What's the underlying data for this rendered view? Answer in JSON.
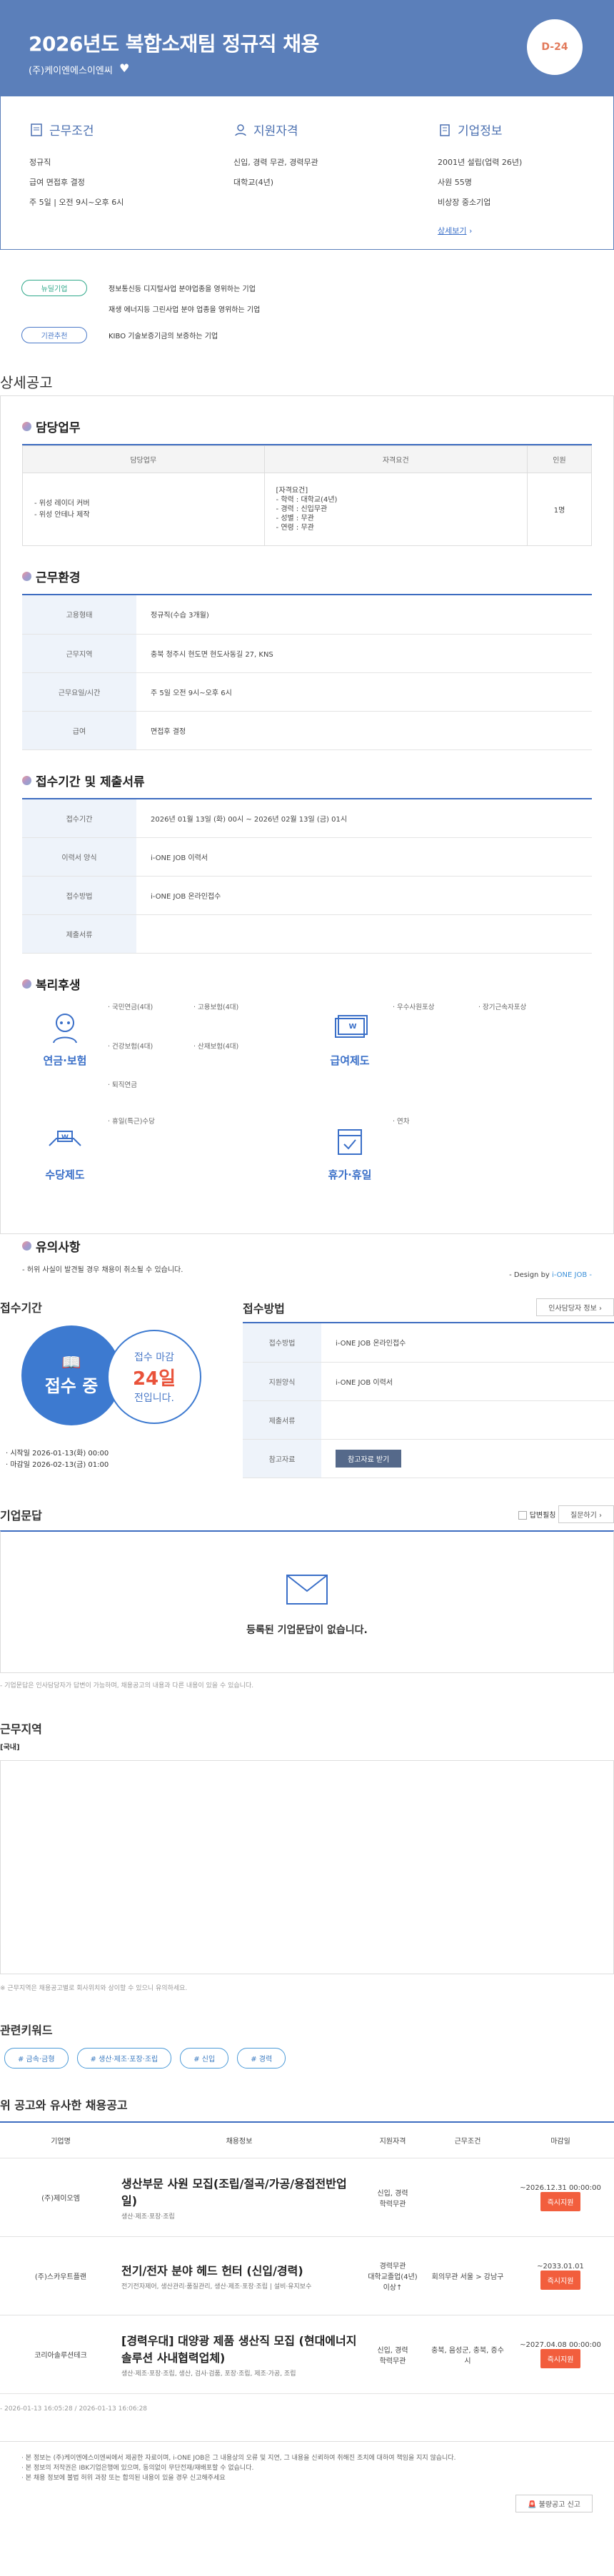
{
  "header": {
    "title": "2026년도 복합소재팀 정규직 채용",
    "company": "(주)케이엔에스이엔씨",
    "dday": "D-24"
  },
  "summary": {
    "cond": {
      "title": "근무조건",
      "lines": [
        "정규직",
        "급여 면접후 결정",
        "주 5일 | 오전 9시~오후 6시"
      ]
    },
    "qual": {
      "title": "지원자격",
      "lines": [
        "신입, 경력 무관, 경력무관",
        "대학교(4년)"
      ]
    },
    "company": {
      "title": "기업정보",
      "lines": [
        "2001년 설립(업력 26년)",
        "사원 55명",
        "비상장 중소기업"
      ],
      "link": "상세보기"
    }
  },
  "badges": [
    {
      "label": "뉴딜기업",
      "text": "정보통신등 디지털사업 분야업종을 영위하는 기업"
    },
    {
      "label": "",
      "text": "재생 에너지등 그린사업 분야 업종을 영위하는 기업"
    },
    {
      "label": "기관추천",
      "text": "KIBO 기술보증기금의 보증하는 기업"
    }
  ],
  "detail": {
    "title": "상세공고"
  },
  "duty": {
    "title": "담당업무",
    "headers": [
      "담당업무",
      "자격요건",
      "인원"
    ],
    "tasks": [
      "- 위성 레이더 커버",
      "- 위성 안테나 제작"
    ],
    "quals": [
      "[자격요건]",
      "- 학력 : 대학교(4년)",
      "- 경력 : 신입무관",
      "- 성별 : 무관",
      "- 연령 : 무관"
    ],
    "count": "1명"
  },
  "env": {
    "title": "근무환경",
    "rows": [
      {
        "k": "고용형태",
        "v": "정규직(수습 3개월)"
      },
      {
        "k": "근무지역",
        "v": "충북 청주시 현도면 현도사동길 27, KNS"
      },
      {
        "k": "근무요일/시간",
        "v": "주 5일 오전 9시~오후 6시"
      },
      {
        "k": "급여",
        "v": "면접후 결정"
      }
    ]
  },
  "period": {
    "title": "접수기간 및 제출서류",
    "rows": [
      {
        "k": "접수기간",
        "v": "2026년 01월 13일 (화) 00시 ~ 2026년 02월 13일 (금) 01시"
      },
      {
        "k": "이력서 양식",
        "v": "i-ONE JOB 이력서"
      },
      {
        "k": "접수방법",
        "v": "i-ONE JOB 온라인접수"
      },
      {
        "k": "제출서류",
        "v": ""
      }
    ]
  },
  "welfare": {
    "title": "복리후생",
    "groups": [
      {
        "name": "연금·보험",
        "items": [
          "· 국민연금(4대)",
          "· 고용보험(4대)",
          "· 건강보험(4대)",
          "· 산재보험(4대)",
          "· 퇴직연금",
          ""
        ]
      },
      {
        "name": "급여제도",
        "items": [
          "· 우수사원포상",
          "· 장기근속자포상"
        ]
      },
      {
        "name": "수당제도",
        "items": [
          "· 휴일(특근)수당"
        ]
      },
      {
        "name": "휴가·휴일",
        "items": [
          "· 연차"
        ]
      }
    ]
  },
  "notice": {
    "title": "유의사항",
    "text": "- 허위 사실이 발견될 경우 채용이 취소될 수 있습니다.",
    "design_prefix": "- Design by ",
    "design_brand": "i-ONE JOB -"
  },
  "receive": {
    "title": "접수기간",
    "status": "접수 중",
    "deadline_label": "접수 마감",
    "days": "24일",
    "deadline_suffix": "전입니다.",
    "start": "· 시작일 2026-01-13(화) 00:00",
    "end": "· 마감일 2026-02-13(금) 01:00"
  },
  "method": {
    "title": "접수방법",
    "link": "인사담당자 정보",
    "rows": [
      {
        "k": "접수방법",
        "v": "i-ONE JOB 온라인접수"
      },
      {
        "k": "지원양식",
        "v": "i-ONE JOB 이력서"
      },
      {
        "k": "제출서류",
        "v": ""
      },
      {
        "k": "참고자료",
        "v": ""
      }
    ],
    "ref_btn": "참고자료 받기"
  },
  "qna": {
    "title": "기업문답",
    "checkbox": "답변필칭",
    "sort": "질문하기",
    "empty": "등록된 기업문답이 없습니다.",
    "note": "- 기업문답은 인사담당자가 답변이 가능하며, 채용공고의 내용과 다른 내용이 있을 수 있습니다."
  },
  "location": {
    "title": "근무지역",
    "sub": "[국내]",
    "note": "※ 근무지역은 채용공고별로 회사위치와 상이할 수 있으니 유의하세요."
  },
  "keywords": {
    "title": "관련키워드",
    "tags": [
      "# 금속·금형",
      "# 생산·제조·포장·조립",
      "# 신입",
      "# 경력"
    ]
  },
  "similar": {
    "title": "위 공고와 유사한 채용공고",
    "headers": [
      "기업명",
      "채용정보",
      "지원자격",
      "근무조건",
      "마감일"
    ],
    "rows": [
      {
        "co": "(주)제이오엠",
        "title": "생산부문 사원 모집(조립/절곡/가공/용접전반업일)",
        "sub": "생산·제조·포장·조립",
        "qual": "신입, 경력\n학력무관",
        "cond": "",
        "due": "~2026.12.31 00:00:00",
        "btn": "즉시지원"
      },
      {
        "co": "(주)스카우트플랜",
        "title": "전기/전자 분야 헤드 헌터 (신입/경력)",
        "sub": "전기전자제어, 생산관리·품질관리, 생산·제조·포장·조립 | 설비·유지보수",
        "qual": "경력무관\n대학교졸업(4년)\n이상↑",
        "cond": "회의무관\n서울 > 강남구",
        "due": "~2033.01.01",
        "btn": "즉시지원"
      },
      {
        "co": "코리아솔루션테크",
        "title": "[경력우대] 대양광 제품 생산직 모집 (현대에너지솔루션 사내협력업체)",
        "sub": "생산·제조·포장·조립, 생산, 검사·검품, 포장·조립, 제조·가공, 조립",
        "qual": "신입, 경력\n학력무관",
        "cond": "충북, 음성군, 충북, 증수시",
        "due": "~2027.04.08 00:00:00",
        "btn": "즉시지원"
      }
    ]
  },
  "footer": {
    "meta": "- 2026-01-13 16:05:28 / 2026-01-13 16:06:28",
    "notes": [
      "· 본 정보는 (주)케이엔에스이엔씨에서 제공한 자료이며, i-ONE JOB은 그 내용상의 오류 및 지연, 그 내용을 신뢰하여 취해진 조치에 대하여 책임을 지지 않습니다.",
      "· 본 정보의 저작권은 IBK기업은행에 있으며, 동의없이 무단전재/재배포할 수 없습니다.",
      "· 본 채용 정보에 불법 허위 과장 또는 합의된 내용이 있을 경우 신고해주세요"
    ],
    "report": "불량공고 신고"
  }
}
